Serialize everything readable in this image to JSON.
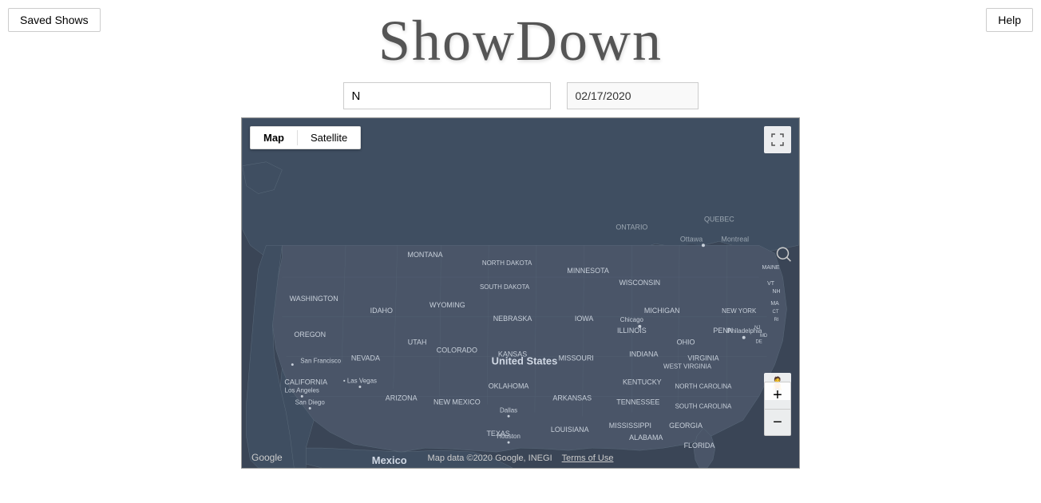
{
  "header": {
    "saved_shows_label": "Saved Shows",
    "title": "ShowDown",
    "help_label": "Help"
  },
  "search": {
    "input_value": "N",
    "input_placeholder": "N",
    "date_value": "02/17/2020"
  },
  "map": {
    "toggle_map_label": "Map",
    "toggle_satellite_label": "Satellite",
    "attribution": "Map data ©2020 Google, INEGI",
    "terms_label": "Terms of Use",
    "google_label": "Google",
    "zoom_in_label": "+",
    "zoom_out_label": "−",
    "states": [
      "WASHINGTON",
      "OREGON",
      "CALIFORNIA",
      "NEVADA",
      "IDAHO",
      "UTAH",
      "ARIZONA",
      "MONTANA",
      "WYOMING",
      "COLORADO",
      "NEW MEXICO",
      "NORTH DAKOTA",
      "SOUTH DAKOTA",
      "NEBRASKA",
      "KANSAS",
      "OKLAHOMA",
      "TEXAS",
      "MINNESOTA",
      "IOWA",
      "MISSOURI",
      "ARKANSAS",
      "LOUISIANA",
      "WISCONSIN",
      "ILLINOIS",
      "MICHIGAN",
      "INDIANA",
      "KENTUCKY",
      "TENNESSEE",
      "MISSISSIPPI",
      "ALABAMA",
      "OHIO",
      "WEST VIRGINIA",
      "VIRGINIA",
      "NORTH CAROLINA",
      "SOUTH CAROLINA",
      "GEORGIA",
      "FLORIDA",
      "PENN",
      "NEW YORK",
      "VT",
      "NH",
      "MA",
      "CT",
      "RI",
      "ME",
      "MD",
      "DE",
      "NJ"
    ],
    "cities": [
      "Chicago",
      "Philadelphia",
      "San Francisco",
      "Las Vegas",
      "Los Angeles",
      "San Diego",
      "Dallas",
      "Houston"
    ],
    "countries": [
      "United States",
      "Mexico"
    ],
    "canada_regions": [
      "ONTARIO",
      "QUEBEC",
      "Ottawa",
      "Montreal"
    ],
    "zoom_level": 5
  }
}
